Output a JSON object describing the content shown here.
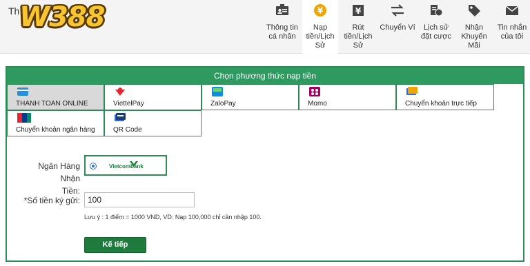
{
  "header": {
    "brand_prefix": "Th",
    "logo_text": "W388",
    "nav": [
      {
        "label": "Thông tin cá nhân",
        "icon": "id-card-icon"
      },
      {
        "label": "Nạp tiền/Lịch Sử",
        "icon": "yen-coin-icon",
        "active": true
      },
      {
        "label": "Rút tiền/Lịch Sử",
        "icon": "yen-box-icon"
      },
      {
        "label": "Chuyển Ví",
        "icon": "transfer-arrows-icon"
      },
      {
        "label": "Lịch sử đặt cược",
        "icon": "coins-icon"
      },
      {
        "label": "Nhận Khuyến Mãi",
        "icon": "tag-icon"
      },
      {
        "label": "Tin nhắn của tôi",
        "icon": "envelope-icon"
      }
    ]
  },
  "panel": {
    "title": "Chọn phương thức nạp tiền",
    "methods": [
      {
        "label": "THANH TOAN ONLINE",
        "icon": "card-icon",
        "selected": true
      },
      {
        "label": "ViettelPay",
        "icon": "viettelpay-icon"
      },
      {
        "label": "ZaloPay",
        "icon": "zalopay-icon"
      },
      {
        "label": "Momo",
        "icon": "momo-icon"
      },
      {
        "label": "Chuyển khoản trực tiếp",
        "icon": "bank-card-icon"
      },
      {
        "label": "Chuyển khoản ngân hàng",
        "icon": "unionpay-icon"
      },
      {
        "label": "QR Code",
        "icon": "qr-card-icon"
      }
    ]
  },
  "form": {
    "bank_label_line1": "Ngân Hàng Nhận",
    "bank_label_line2": "Tiền:",
    "bank_name": "Vietcombank",
    "amount_label": "*Số tiền ký gửi:",
    "amount_value": "100",
    "note": "Lưu ý : 1 điểm = 1000 VND, VD: Nạp 100,000 chỉ cần nhập 100.",
    "submit_label": "Kế tiếp"
  },
  "colors": {
    "accent": "#2f9a5f",
    "button": "#1f7a3e",
    "logo": "#f6c531"
  }
}
